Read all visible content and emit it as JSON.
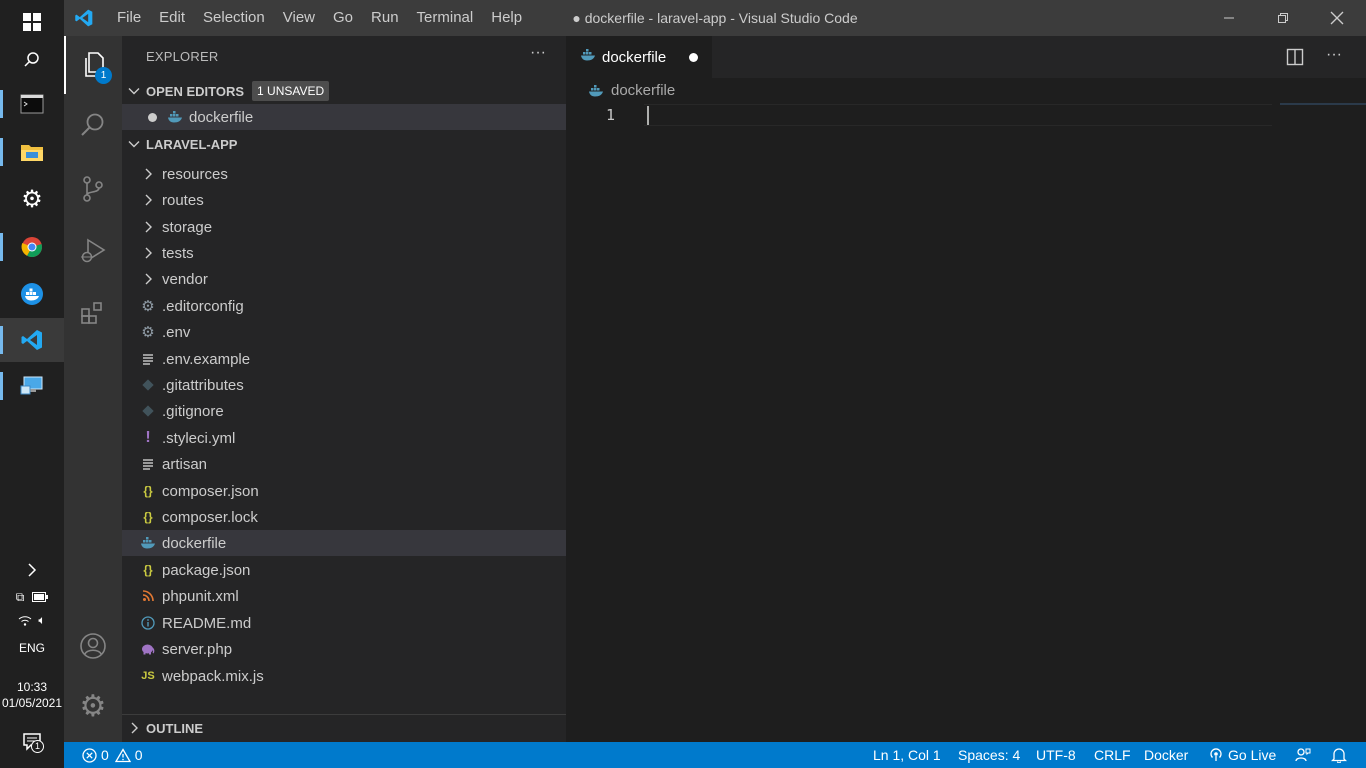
{
  "taskbar": {
    "language": "ENG",
    "time": "10:33",
    "date": "01/05/2021",
    "notification_count": "1"
  },
  "titlebar": {
    "menu": [
      "File",
      "Edit",
      "Selection",
      "View",
      "Go",
      "Run",
      "Terminal",
      "Help"
    ],
    "window_title": "● dockerfile - laravel-app - Visual Studio Code"
  },
  "activity_bar": {
    "explorer_badge": "1"
  },
  "sidebar": {
    "title": "EXPLORER",
    "open_editors": {
      "label": "OPEN EDITORS",
      "badge": "1 UNSAVED",
      "files": [
        {
          "name": "dockerfile",
          "dirty": true,
          "icon": "docker-icon"
        }
      ]
    },
    "project": {
      "label": "LARAVEL-APP",
      "items": [
        {
          "name": "resources",
          "type": "folder"
        },
        {
          "name": "routes",
          "type": "folder"
        },
        {
          "name": "storage",
          "type": "folder"
        },
        {
          "name": "tests",
          "type": "folder"
        },
        {
          "name": "vendor",
          "type": "folder"
        },
        {
          "name": ".editorconfig",
          "icon": "gear-icon"
        },
        {
          "name": ".env",
          "icon": "gear-icon"
        },
        {
          "name": ".env.example",
          "icon": "text-lines-icon"
        },
        {
          "name": ".gitattributes",
          "icon": "git-icon"
        },
        {
          "name": ".gitignore",
          "icon": "git-icon"
        },
        {
          "name": ".styleci.yml",
          "icon": "yaml-icon"
        },
        {
          "name": "artisan",
          "icon": "text-lines-icon"
        },
        {
          "name": "composer.json",
          "icon": "json-icon"
        },
        {
          "name": "composer.lock",
          "icon": "json-icon"
        },
        {
          "name": "dockerfile",
          "icon": "docker-icon",
          "selected": true
        },
        {
          "name": "package.json",
          "icon": "json-icon"
        },
        {
          "name": "phpunit.xml",
          "icon": "rss-icon"
        },
        {
          "name": "README.md",
          "icon": "info-icon"
        },
        {
          "name": "server.php",
          "icon": "php-elephant-icon"
        },
        {
          "name": "webpack.mix.js",
          "icon": "js-icon"
        }
      ]
    },
    "outline_label": "OUTLINE"
  },
  "editor": {
    "tab_label": "dockerfile",
    "breadcrumb": "dockerfile",
    "line_number": "1"
  },
  "statusbar": {
    "errors": "0",
    "warnings": "0",
    "position": "Ln 1, Col 1",
    "spaces": "Spaces: 4",
    "encoding": "UTF-8",
    "eol": "CRLF",
    "language": "Docker",
    "go_live": "Go Live"
  },
  "colors": {
    "accent": "#007acc",
    "json_icon": "#cbcb41",
    "docker_icon": "#519aba",
    "yaml_icon": "#a074c4",
    "rss_icon": "#e37933"
  }
}
